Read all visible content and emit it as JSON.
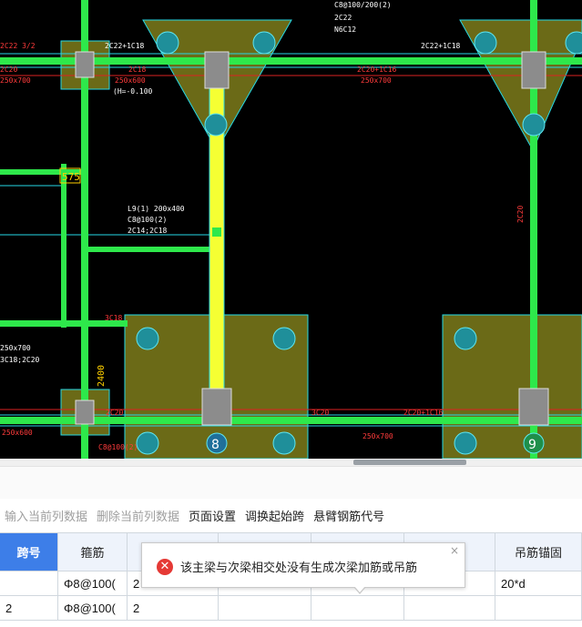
{
  "cad": {
    "texts": {
      "t1": "C8@100/200(2)",
      "t2": "2C22",
      "t3": "N6C12",
      "t4": "2C22+1C18",
      "t5": "2C22+1C18",
      "t6": "2C18",
      "t7": "250x600",
      "t8": "(H=-0.100",
      "t9": "2C20+1C16",
      "t10": "250x700",
      "t11": "2C22 3/2",
      "t12": "2C20",
      "t13": "250x700",
      "t14": "L9(1) 200x400",
      "t15": "C8@100(2)",
      "t16": "2C14;2C18",
      "t17": "3C18",
      "t18": "575",
      "t19": "2400",
      "t20": "2C20",
      "t21": "3C20",
      "t22": "2C20+1C16",
      "t23": "250x700",
      "t24": "250x600",
      "t25": "C8@100(2)",
      "t26": "250x700",
      "t27": "3C18;2C20",
      "t28": "2C20"
    },
    "axis_labels": [
      "8",
      "9"
    ]
  },
  "toolbar": {
    "items": [
      {
        "label": "输入当前列数据",
        "enabled": false
      },
      {
        "label": "删除当前列数据",
        "enabled": false
      },
      {
        "label": "页面设置",
        "enabled": true
      },
      {
        "label": "调换起始跨",
        "enabled": true
      },
      {
        "label": "悬臂钢筋代号",
        "enabled": true
      }
    ]
  },
  "table": {
    "headers": [
      "跨号",
      "箍筋",
      "",
      "",
      "",
      "",
      "吊筋锚固"
    ],
    "rows": [
      [
        "",
        "Φ8@100(",
        "2",
        "",
        "",
        "",
        "20*d"
      ],
      [
        "2",
        "Φ8@100(",
        "2",
        "",
        "",
        "",
        ""
      ]
    ]
  },
  "popup": {
    "message": "该主梁与次梁相交处没有生成次梁加筋或吊筋",
    "close": "×",
    "icon": "error-icon"
  },
  "colors": {
    "beam_green": "#2ee84b",
    "selected_beam_yellow": "#f5ff33",
    "column_fill": "#6b6a17",
    "cad_text_red": "#ff3b3b",
    "header_selected_blue": "#3d7ee8"
  }
}
